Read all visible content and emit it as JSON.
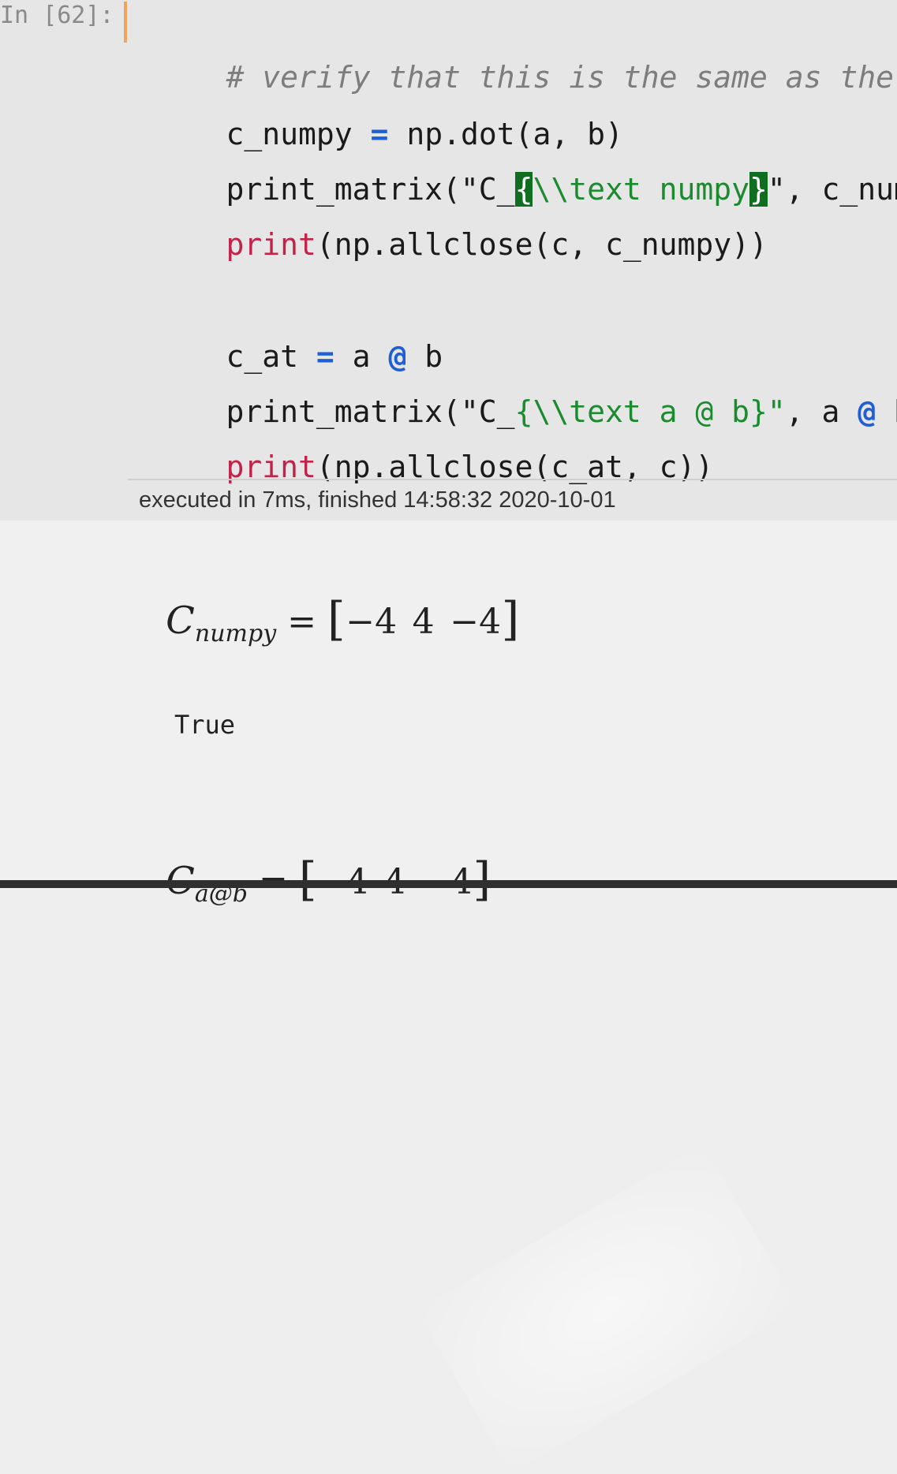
{
  "cell": {
    "prompt": "In [62]:",
    "lines": {
      "l1_comment": "# verify that this is the same as the",
      "l2_a": "c_numpy ",
      "l2_eq": "=",
      "l2_b": " np.dot(a, b)",
      "l3_a": "print_matrix(\"C_",
      "l3_brace_open": "{",
      "l3_str": "\\\\text numpy",
      "l3_brace_close": "}",
      "l3_end": "\", c_num",
      "l4_builtin": "print",
      "l4_rest": "(np.allclose(c, c_numpy))",
      "l6_a": "c_at ",
      "l6_eq": "=",
      "l6_b": " a ",
      "l6_at": "@",
      "l6_c": " b",
      "l7_a": "print_matrix(\"C_",
      "l7_str": "{\\\\text a @ b}\"",
      "l7_b": ", a ",
      "l7_at": "@",
      "l7_c": " b",
      "l8_builtin": "print",
      "l8_rest": "(np.allclose(c_at, c))"
    },
    "exec_info": "executed in 7ms, finished 14:58:32 2020-10-01"
  },
  "output": {
    "matrix1": {
      "symbol": "C",
      "subscript": "numpy",
      "equals": "=",
      "values": [
        "−4",
        "4",
        "−4"
      ]
    },
    "print_result": "True",
    "matrix2": {
      "symbol": "C",
      "subscript": "a@b",
      "equals": "=",
      "values": [
        "−4",
        "4",
        "−4"
      ]
    }
  },
  "colors": {
    "comment": "#7d7d7d",
    "operator": "#1f5fd6",
    "string": "#1c8a2e",
    "builtin": "#c0244a",
    "bracket_match": "#0f6e1f",
    "cell_marker": "#f0a35a"
  }
}
